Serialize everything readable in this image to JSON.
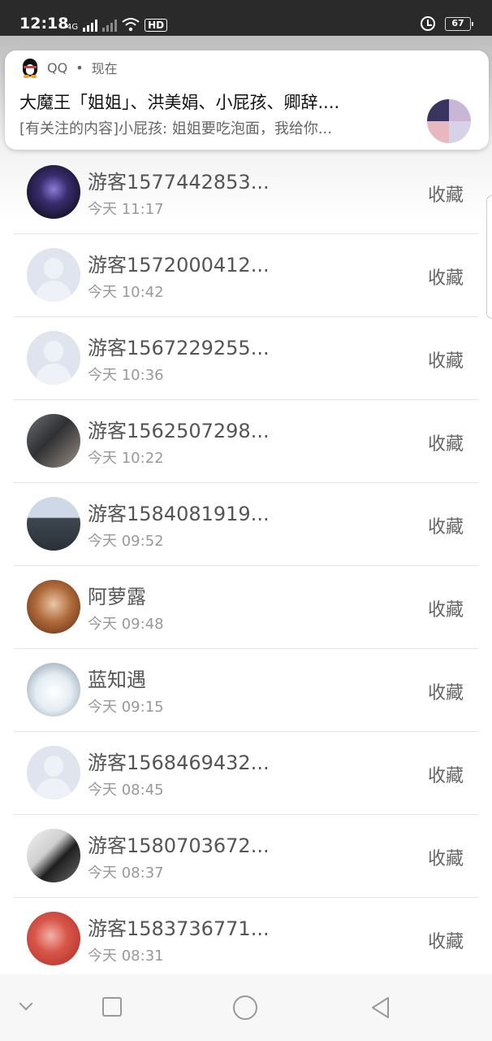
{
  "status_bar": {
    "time": "12:18",
    "network": "4G",
    "hd_label": "HD",
    "battery": "67"
  },
  "notification": {
    "app_name": "QQ",
    "separator": "•",
    "when": "现在",
    "title": "大魔王「姐姐」、洪美娟、小屁孩、卿辞....",
    "text": "[有关注的内容]小屁孩: 姐姐要吃泡面，我给你..."
  },
  "visitors": [
    {
      "name": "游客1577442853...",
      "time": "今天 11:17",
      "action": "收藏",
      "avatar": "photo-galaxy"
    },
    {
      "name": "游客1572000412...",
      "time": "今天 10:42",
      "action": "收藏",
      "avatar": "default"
    },
    {
      "name": "游客1567229255...",
      "time": "今天 10:36",
      "action": "收藏",
      "avatar": "default"
    },
    {
      "name": "游客1562507298...",
      "time": "今天 10:22",
      "action": "收藏",
      "avatar": "photo-group"
    },
    {
      "name": "游客1584081919...",
      "time": "今天 09:52",
      "action": "收藏",
      "avatar": "photo-crowd"
    },
    {
      "name": "阿萝露",
      "time": "今天 09:48",
      "action": "收藏",
      "avatar": "photo-portrait"
    },
    {
      "name": "蓝知遇",
      "time": "今天 09:15",
      "action": "收藏",
      "avatar": "photo-white"
    },
    {
      "name": "游客1568469432...",
      "time": "今天 08:45",
      "action": "收藏",
      "avatar": "default"
    },
    {
      "name": "游客1580703672...",
      "time": "今天 08:37",
      "action": "收藏",
      "avatar": "photo-bw"
    },
    {
      "name": "游客1583736771...",
      "time": "今天 08:31",
      "action": "收藏",
      "avatar": "photo-red"
    }
  ],
  "colors": {
    "status_bar": "#2a2a2a",
    "default_avatar": "#dfe4ef",
    "divider": "#e4e4e4"
  }
}
